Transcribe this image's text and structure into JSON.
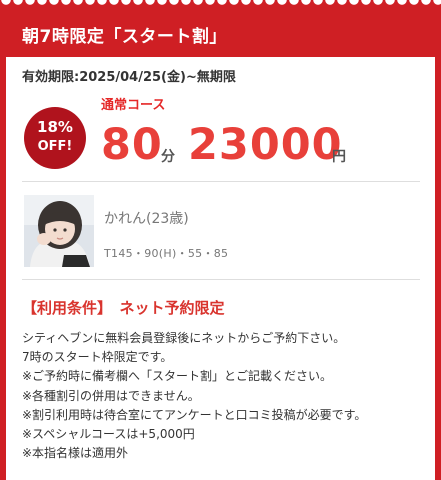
{
  "header": {
    "title": "朝7時限定「スタート割」"
  },
  "validity": "有効期限:2025/04/25(金)~無期限",
  "badge": {
    "percent": "18%",
    "off": "OFF!"
  },
  "course": {
    "name": "通常コース",
    "minutes": "80",
    "minutes_unit": "分",
    "price": "23000",
    "price_unit": "円"
  },
  "girl": {
    "name": "かれん(23歳)",
    "stats": "T145・90(H)・55・85"
  },
  "conditions": {
    "title": "【利用条件】　ネット予約限定",
    "lines": [
      "シティヘブンに無料会員登録後にネットからご予約下さい。",
      "7時のスタート枠限定です。",
      "※ご予約時に備考欄へ「スタート割」とご記載ください。",
      "※各種割引の併用はできません。",
      "※割引利用時は待合室にてアンケートと口コミ投稿が必要です。",
      "※スペシャルコースは+5,000円",
      "※本指名様は適用外"
    ]
  },
  "colors": {
    "accent": "#cf1f24",
    "price": "#e8403a",
    "badge": "#b0131d"
  }
}
